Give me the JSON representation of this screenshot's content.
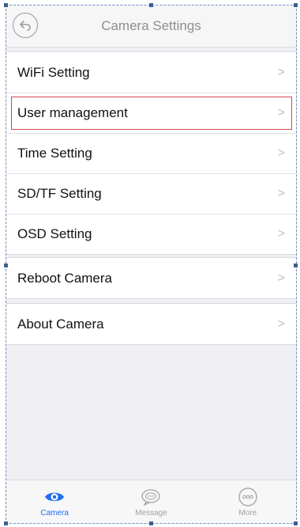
{
  "header": {
    "title": "Camera Settings",
    "back_icon": "back-arrow-icon"
  },
  "settings_group": {
    "items": [
      {
        "label": "WiFi Setting"
      },
      {
        "label": "User management",
        "highlighted": true
      },
      {
        "label": "Time Setting"
      },
      {
        "label": "SD/TF Setting"
      },
      {
        "label": "OSD Setting"
      }
    ]
  },
  "reboot_group": {
    "items": [
      {
        "label": "Reboot Camera"
      }
    ]
  },
  "about_group": {
    "items": [
      {
        "label": "About Camera"
      }
    ]
  },
  "chevron": ">",
  "tabbar": {
    "tabs": [
      {
        "label": "Camera",
        "icon": "eye-icon",
        "active": true
      },
      {
        "label": "Message",
        "icon": "chat-bubble-icon",
        "active": false
      },
      {
        "label": "More",
        "icon": "more-dots-icon",
        "active": false
      }
    ]
  },
  "colors": {
    "accent": "#1d6ef2",
    "highlight_border": "#d2474d",
    "background": "#efeff4"
  }
}
